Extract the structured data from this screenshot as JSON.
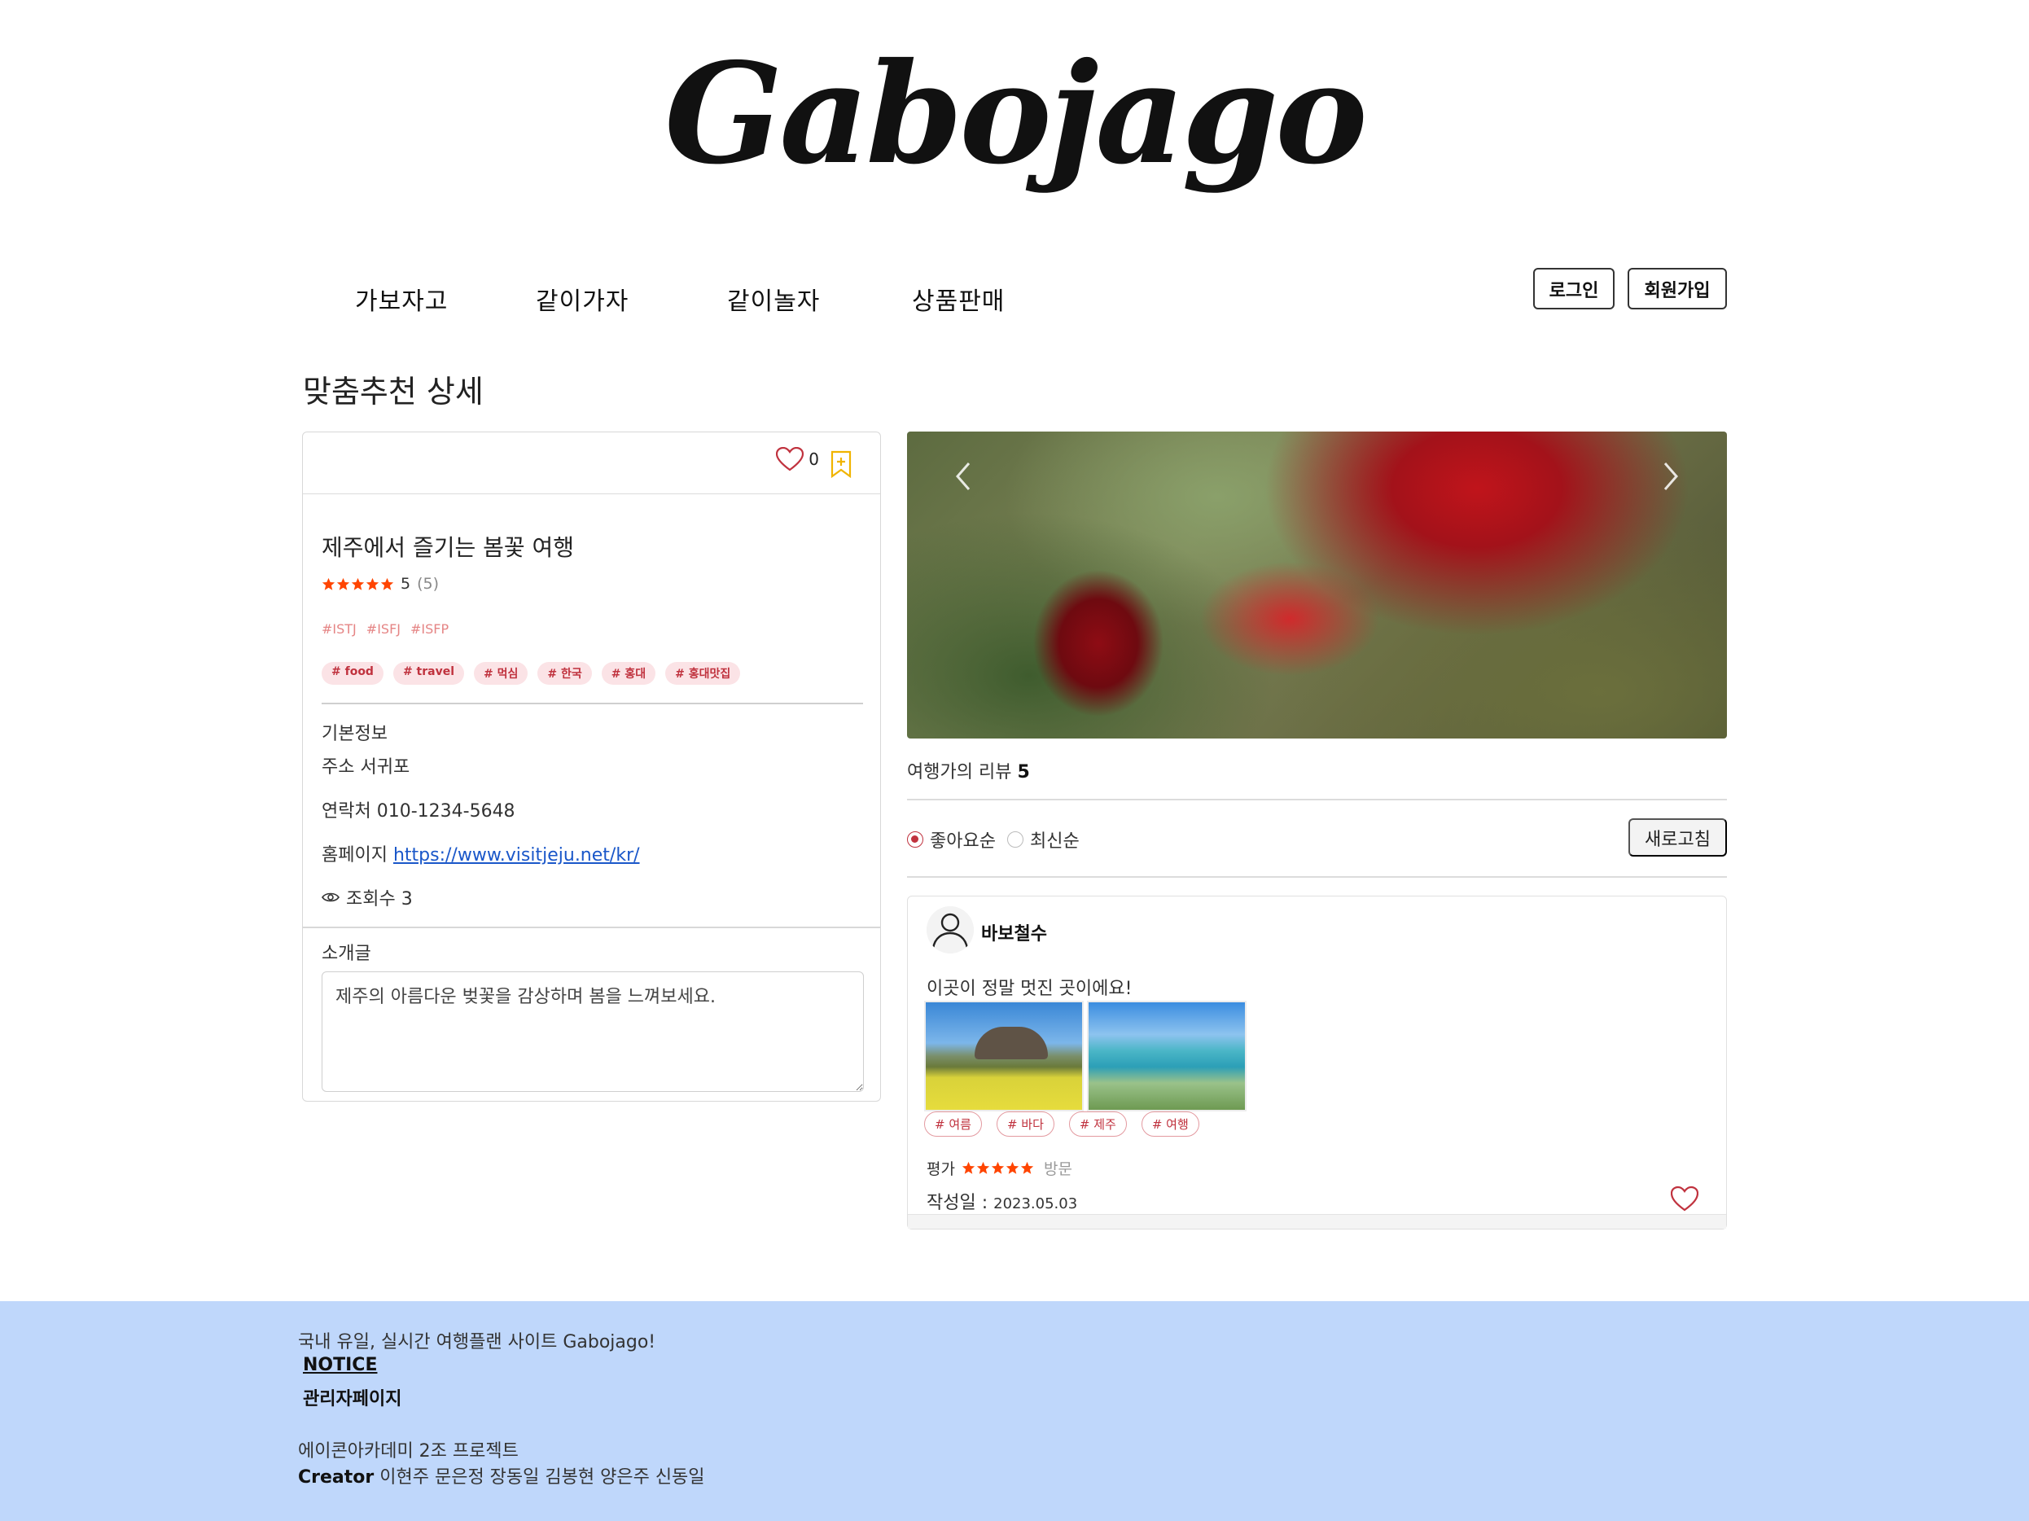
{
  "header": {
    "logo": "Gabojago",
    "nav": [
      "가보자고",
      "같이가자",
      "같이놀자",
      "상품판매"
    ],
    "login_label": "로그인",
    "signup_label": "회원가입"
  },
  "page_title": "맞춤추천 상세",
  "detail": {
    "like_count": "0",
    "title": "제주에서 즐기는 봄꽃 여행",
    "rating_value": "5",
    "rating_count": "(5)",
    "stars": 5,
    "mbti_tags": [
      "#ISTJ",
      "#ISFJ",
      "#ISFP"
    ],
    "tags": [
      "# food",
      "# travel",
      "# 먹심",
      "# 한국",
      "# 홍대",
      "# 홍대맛집"
    ],
    "basic_info_label": "기본정보",
    "address": "주소 서귀포",
    "contact": "연락처 010-1234-5648",
    "homepage_label": "홈페이지",
    "homepage_url": "https://www.visitjeju.net/kr/",
    "views": "조회수 3",
    "intro_label": "소개글",
    "intro_text": "제주의 아름다운 벚꽃을 감상하며 봄을 느껴보세요."
  },
  "reviews": {
    "heading": "여행가의 리뷰",
    "count": "5",
    "sort_options": [
      "좋아요순",
      "최신순"
    ],
    "sort_selected": "좋아요순",
    "refresh_label": "새로고침",
    "items": [
      {
        "author": "바보철수",
        "text": "이곳이 정말 멋진 곳이에요!",
        "tags": [
          "# 여름",
          "# 바다",
          "# 제주",
          "# 여행"
        ],
        "score_label": "평가",
        "stars": 5,
        "visit_label": "방문",
        "date_label": "작성일 : ",
        "date": "2023.05.03"
      }
    ]
  },
  "footer": {
    "tagline": "국내 유일, 실시간 여행플랜 사이트 Gabojago!",
    "notice": "NOTICE",
    "admin": "관리자페이지",
    "project": "에이콘아카데미 2조 프로젝트",
    "creator_label": "Creator",
    "creators": "이현주 문은정 장동일 김봉현 양은주 신동일"
  },
  "colors": {
    "accent": "#c0323e",
    "star": "#ff4500",
    "footer_bg": "#bfd7fb",
    "link": "#1a57c9",
    "bookmark": "#f0b400"
  },
  "icons": [
    "heart-icon",
    "bookmark-icon",
    "star-icon",
    "eye-icon",
    "chevron-left-icon",
    "chevron-right-icon",
    "user-icon"
  ]
}
